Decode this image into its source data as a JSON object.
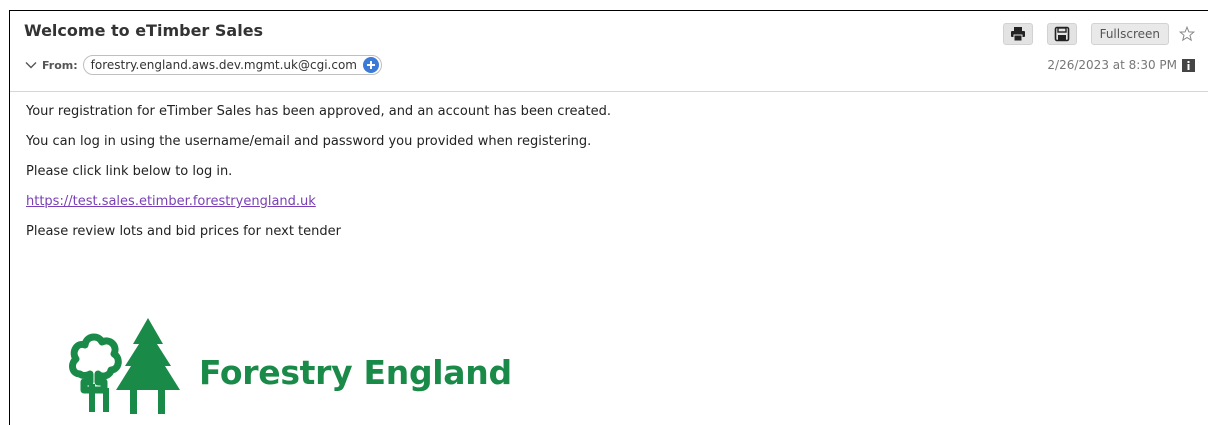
{
  "message": {
    "subject": "Welcome to eTimber Sales",
    "from_label": "From:",
    "sender": "forestry.england.aws.dev.mgmt.uk@cgi.com",
    "date": "2/26/2023 at 8:30 PM"
  },
  "toolbar": {
    "fullscreen_label": "Fullscreen"
  },
  "body": {
    "line1": "Your registration for eTimber Sales has been approved, and an account has been created.",
    "line2": "You can log in using the username/email and password you provided when registering.",
    "line3": "Please click link below to log in.",
    "link": "https://test.sales.etimber.forestryengland.uk",
    "line4": "Please review lots and bid prices for next tender"
  },
  "logo": {
    "text": "Forestry England"
  },
  "colors": {
    "brand_green": "#1a8a48",
    "link": "#7a3fb5",
    "add_blue": "#3b7bd6"
  }
}
